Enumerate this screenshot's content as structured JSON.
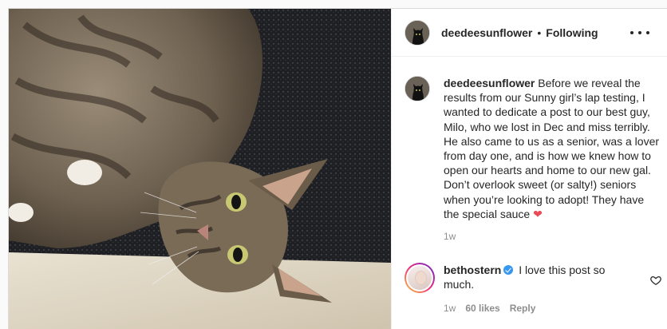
{
  "post": {
    "image_alt": "Tabby cat lying on a black rug",
    "header": {
      "username": "deedeesunflower",
      "separator": "•",
      "follow_status": "Following",
      "more_icon": "more-horizontal-icon"
    },
    "caption": {
      "username": "deedeesunflower",
      "text": "Before we reveal the results from our Sunny girl’s lap testing, I wanted to dedicate a post to our best guy, Milo, who we lost in Dec and miss terribly. He also came to us as a senior, was a lover from day one, and is how we knew how to open our hearts and home to our new gal. Don’t overlook sweet (or salty!) seniors when you’re looking to adopt! They have the special sauce",
      "emoji": "❤",
      "timestamp": "1w"
    },
    "comments": [
      {
        "username": "bethostern",
        "verified": true,
        "text": "I love this post so much.",
        "timestamp": "1w",
        "likes": "60 likes",
        "reply_label": "Reply"
      }
    ]
  },
  "colors": {
    "heart": "#ed4956",
    "verified": "#3897f0",
    "muted": "#8e8e8e"
  }
}
